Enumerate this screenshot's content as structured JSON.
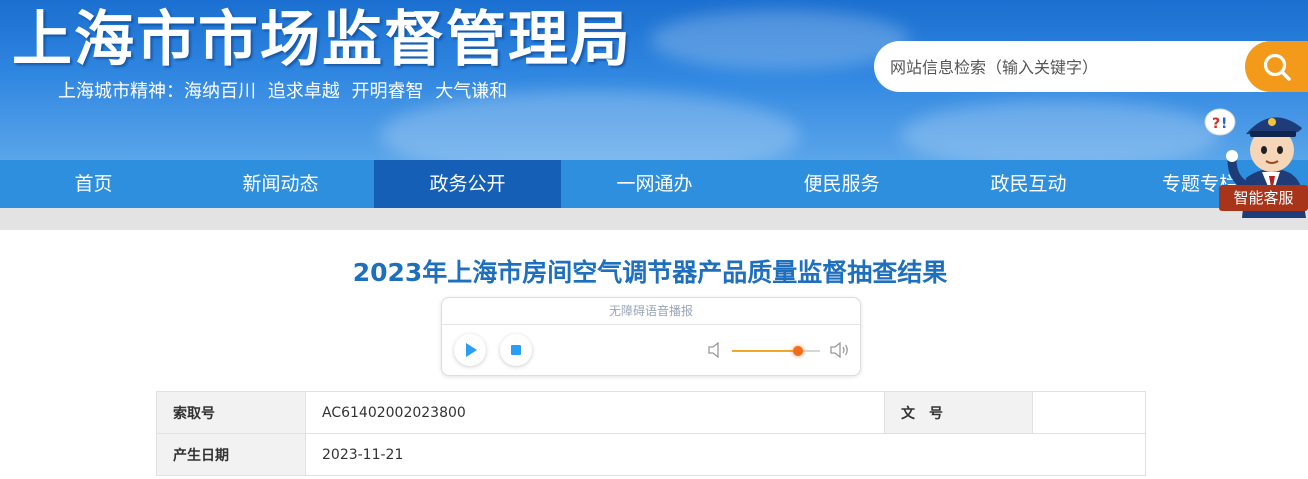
{
  "header": {
    "site_title": "上海市市场监督管理局",
    "slogan": [
      "上海城市精神：海纳百川",
      "追求卓越",
      "开明睿智",
      "大气谦和"
    ],
    "search": {
      "placeholder": "网站信息检索（输入关键字）",
      "icon": "search-icon"
    }
  },
  "nav": {
    "items": [
      {
        "label": "首页",
        "active": false
      },
      {
        "label": "新闻动态",
        "active": false
      },
      {
        "label": "政务公开",
        "active": true
      },
      {
        "label": "一网通办",
        "active": false
      },
      {
        "label": "便民服务",
        "active": false
      },
      {
        "label": "政民互动",
        "active": false
      },
      {
        "label": "专题专栏",
        "active": false
      }
    ]
  },
  "assistant": {
    "label": "智能客服",
    "icon": "robot-assistant-icon"
  },
  "article": {
    "title": "2023年上海市房间空气调节器产品质量监督抽查结果"
  },
  "player": {
    "label": "无障碍语音播报",
    "volume": 0.75,
    "icons": [
      "play-icon",
      "stop-icon",
      "volume-low-icon",
      "volume-high-icon"
    ]
  },
  "info": {
    "index_label": "索取号",
    "index_value": "AC61402002023800",
    "doc_label": "文　号",
    "doc_value": "",
    "date_label": "产生日期",
    "date_value": "2023-11-21"
  },
  "colors": {
    "header_blue": "#2f86e0",
    "nav_blue": "#2d8fde",
    "nav_active": "#1560b6",
    "search_orange": "#f39a1b",
    "title_blue": "#1f6fbf"
  }
}
